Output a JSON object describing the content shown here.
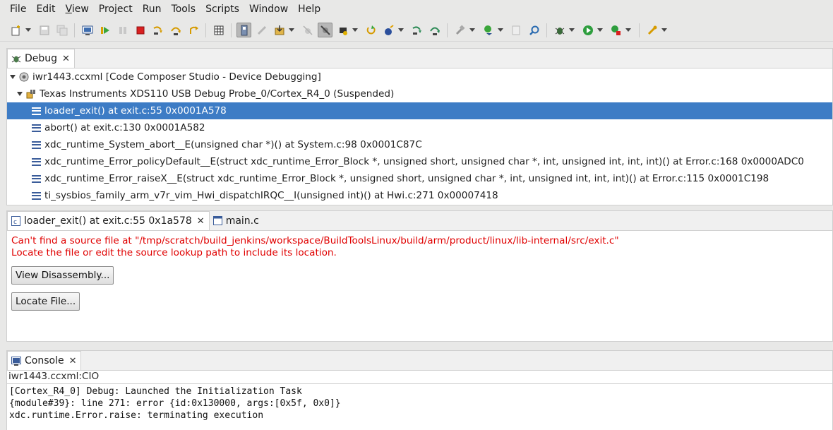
{
  "menu": [
    "File",
    "Edit",
    "View",
    "Project",
    "Run",
    "Tools",
    "Scripts",
    "Window",
    "Help"
  ],
  "toolbar": {
    "icons": [
      "new-icon",
      "save-icon",
      "save-all-icon",
      "debug-view-icon",
      "resume-icon",
      "suspend-icon",
      "terminate-icon",
      "step-into-icon",
      "step-over-icon",
      "step-return-icon",
      "registers-icon",
      "connect-target-icon",
      "disconnect-icon",
      "load-program-icon",
      "breakpoint-icon",
      "skip-breakpoints-icon",
      "hardware-breakpoint-icon",
      "restart-icon",
      "reset-icon",
      "assembly-step-into-icon",
      "assembly-step-over-icon",
      "build-icon",
      "debug-icon",
      "run-icon",
      "external-tools-icon",
      "open-console-icon",
      "search-icon",
      "debug-bug-icon",
      "run-green-icon",
      "profile-icon",
      "launch-icon"
    ]
  },
  "debug": {
    "tab_label": "Debug",
    "tree": {
      "root": "iwr1443.ccxml [Code Composer Studio - Device Debugging]",
      "target": "Texas Instruments XDS110 USB Debug Probe_0/Cortex_R4_0 (Suspended)",
      "frames": [
        "loader_exit() at exit.c:55 0x0001A578",
        "abort() at exit.c:130 0x0001A582",
        "xdc_runtime_System_abort__E(unsigned char *)() at System.c:98 0x0001C87C",
        "xdc_runtime_Error_policyDefault__E(struct xdc_runtime_Error_Block *, unsigned short, unsigned char *, int, unsigned int, int, int)() at Error.c:168 0x0000ADC0",
        "xdc_runtime_Error_raiseX__E(struct xdc_runtime_Error_Block *, unsigned short, unsigned char *, int, unsigned int, int, int)() at Error.c:115 0x0001C198",
        "ti_sysbios_family_arm_v7r_vim_Hwi_dispatchIRQC__I(unsigned int)() at Hwi.c:271 0x00007418"
      ]
    }
  },
  "editor": {
    "tabs": [
      "loader_exit() at exit.c:55 0x1a578",
      "main.c"
    ],
    "error_line1": "Can't find a source file at \"/tmp/scratch/build_jenkins/workspace/BuildToolsLinux/build/arm/product/linux/lib-internal/src/exit.c\"",
    "error_line2": "Locate the file or edit the source lookup path to include its location.",
    "view_disassembly_label": "View Disassembly...",
    "locate_file_label": "Locate File..."
  },
  "console": {
    "tab_label": "Console",
    "name": "iwr1443.ccxml:CIO",
    "lines": [
      "[Cortex_R4_0] Debug: Launched the Initialization Task",
      "{module#39}: line 271: error {id:0x130000, args:[0x5f, 0x0]}",
      "xdc.runtime.Error.raise: terminating execution"
    ]
  },
  "colors": {
    "selection": "#3d7cc5",
    "error_text": "#e00000",
    "toolbar_bg": "#e8e8e7"
  }
}
